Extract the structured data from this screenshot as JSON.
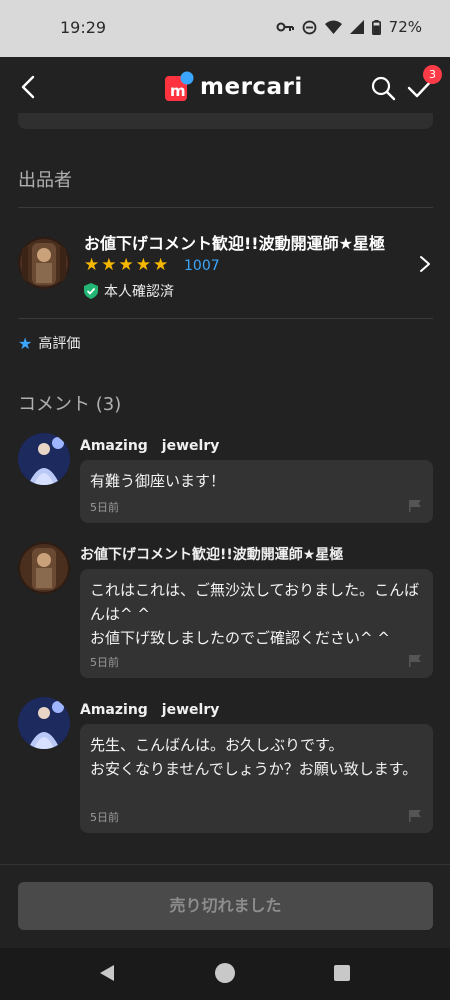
{
  "status_bar": {
    "time": "19:29",
    "battery": "72%"
  },
  "app_bar": {
    "logo_text": "mercari",
    "notification_count": "3"
  },
  "seller_section": {
    "title": "出品者",
    "name": "お値下げコメント歓迎!!波動開運師★星極",
    "rating_stars": 5,
    "rating_count": "1007",
    "verified_label": "本人確認済",
    "high_rating_label": "高評価"
  },
  "comments_section": {
    "title": "コメント (3)",
    "comments": [
      {
        "author": "Amazing　jewelry",
        "text": "有難う御座います！",
        "time": "5日前"
      },
      {
        "author": "お値下げコメント歓迎!!波動開運師★星極",
        "text": "これはこれは、ご無沙汰しておりました。こんばんは^ ^\nお値下げ致しましたのでご確認ください^ ^",
        "time": "5日前"
      },
      {
        "author": "Amazing　jewelry",
        "text": "先生、こんばんは。お久しぶりです。\nお安くなりませんでしょうか？お願い致します。",
        "time": "5日前"
      }
    ]
  },
  "footer": {
    "sold_out_label": "売り切れました"
  },
  "colors": {
    "background": "#222222",
    "star": "#f5b700",
    "link": "#3ba6ff",
    "badge": "#ff3b47",
    "verified": "#22b573",
    "logo_red": "#ff333f",
    "logo_blue": "#3ba6ff"
  }
}
